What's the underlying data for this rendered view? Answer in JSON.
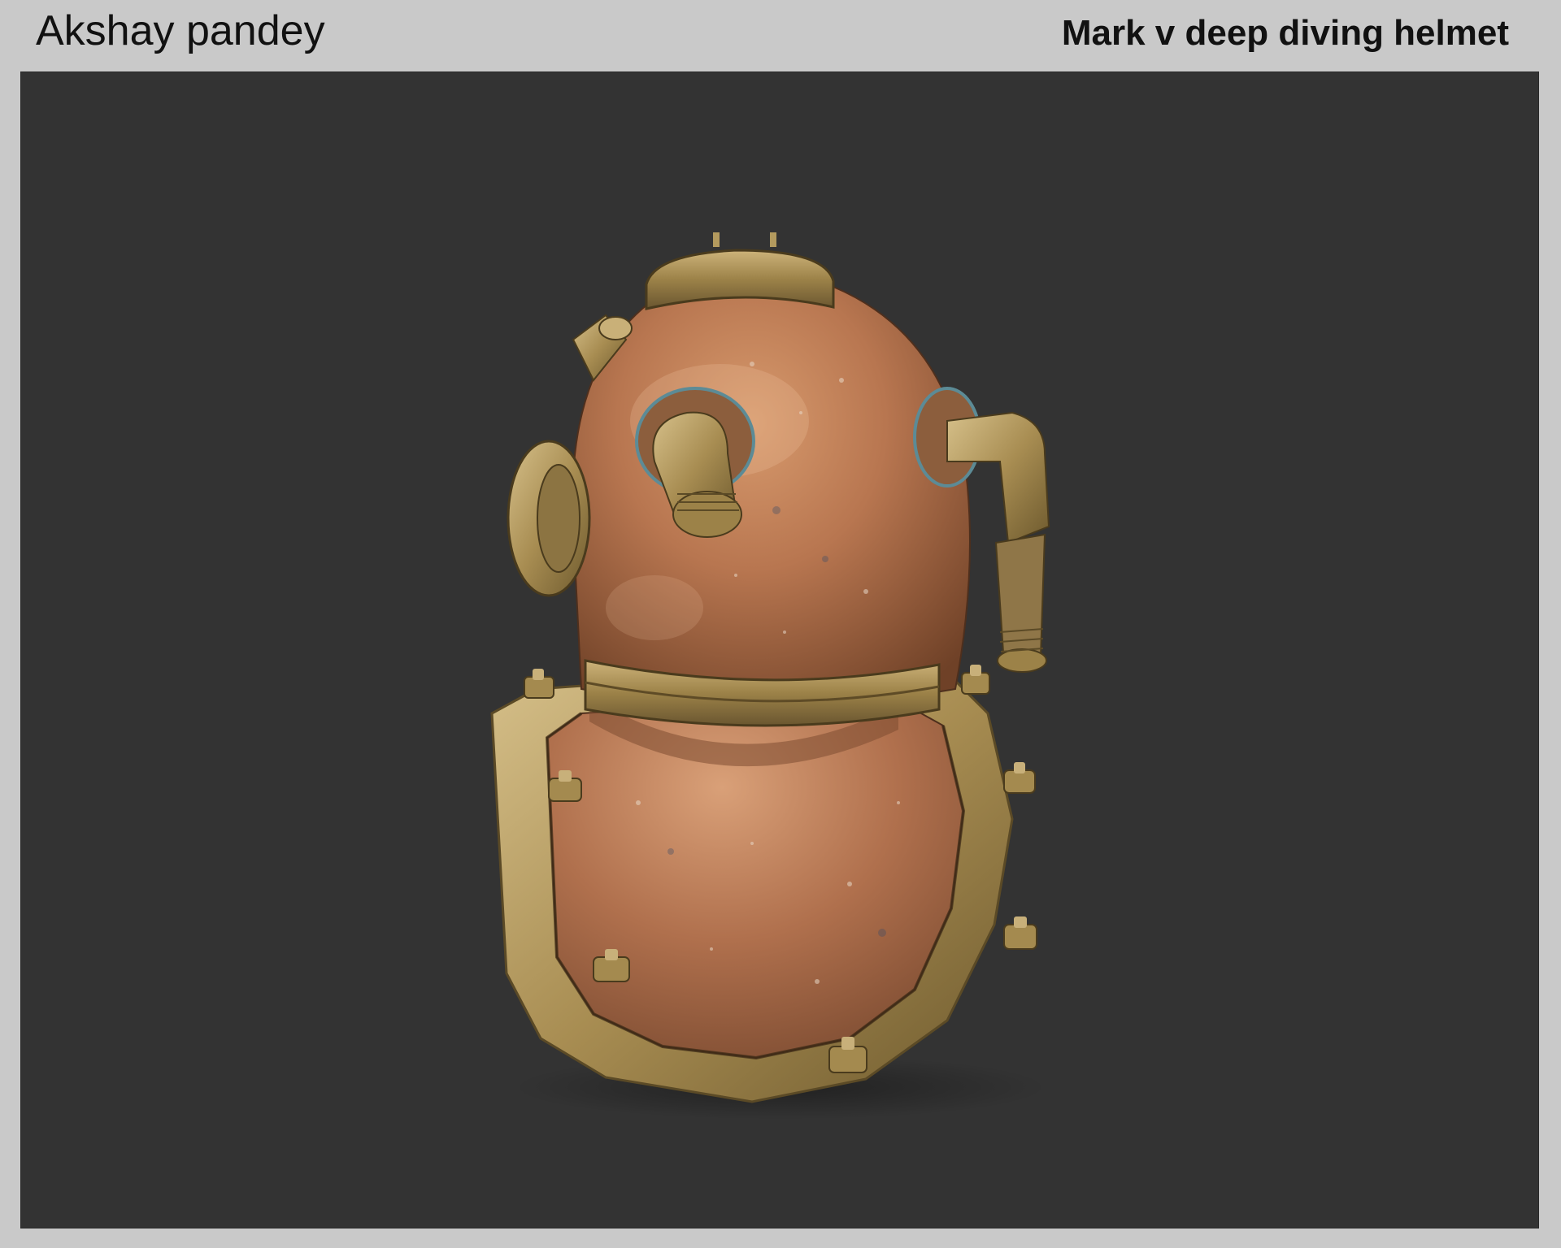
{
  "header": {
    "author": "Akshay pandey",
    "title": "Mark v deep diving helmet"
  },
  "render": {
    "subject_icon": "diving-helmet-icon",
    "background_color": "#333333",
    "copper_color": "#b97a55",
    "brass_color": "#b39a5e"
  }
}
